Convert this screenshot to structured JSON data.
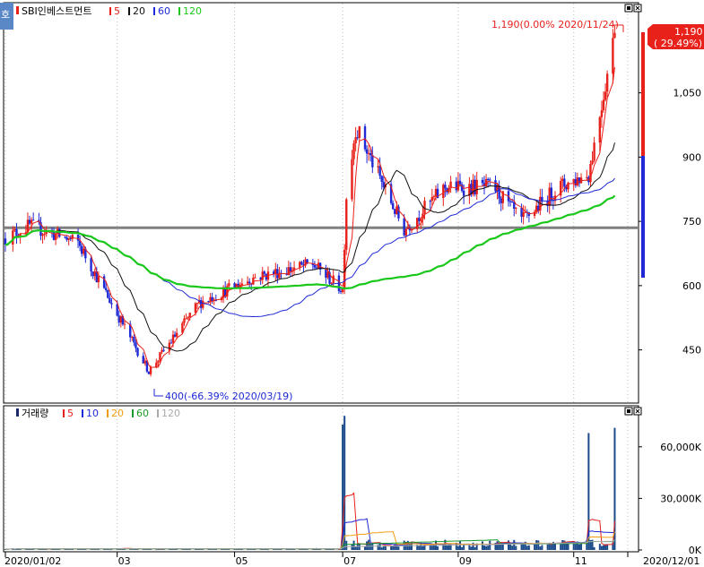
{
  "price_panel": {
    "badge": "호",
    "title": "SBI인베스트먼트",
    "legend": [
      {
        "label": "5",
        "color": "#e8211b"
      },
      {
        "label": "20",
        "color": "#111111"
      },
      {
        "label": "60",
        "color": "#1f2ad6"
      },
      {
        "label": "120",
        "color": "#19c81b"
      }
    ],
    "y_ticks": [
      {
        "label": "1,050",
        "value": 1050
      },
      {
        "label": "900",
        "value": 900
      },
      {
        "label": "750",
        "value": 750
      },
      {
        "label": "600",
        "value": 600
      },
      {
        "label": "450",
        "value": 450
      }
    ],
    "current_price": "1,190",
    "current_change": "( 29.49%)",
    "high_annotation": "1,190(0.00% 2020/11/24)",
    "low_annotation": "400(-66.39% 2020/03/19)"
  },
  "volume_panel": {
    "title": "거래량",
    "legend": [
      {
        "label": "5",
        "color": "#e8211b"
      },
      {
        "label": "10",
        "color": "#1f2ad6"
      },
      {
        "label": "20",
        "color": "#f39c12"
      },
      {
        "label": "60",
        "color": "#1a9a2a"
      },
      {
        "label": "120",
        "color": "#aaaaaa"
      }
    ],
    "y_ticks": [
      {
        "label": "60,000K",
        "value": 60000
      },
      {
        "label": "30,000K",
        "value": 30000
      },
      {
        "label": "0K",
        "value": 0
      }
    ]
  },
  "x_ticks": [
    "2020/01/02",
    "03",
    "05",
    "07",
    "09",
    "11",
    "2020/12/01"
  ],
  "colors": {
    "up": "#e8211b",
    "down": "#1f2ad6",
    "ma5": "#e8211b",
    "ma20": "#111111",
    "ma60": "#1f2ad6",
    "ma120": "#19c81b",
    "hline": "#808080"
  },
  "chart_data": {
    "type": "candlestick",
    "y_range_price": [
      330,
      1250
    ],
    "y_range_volume": [
      0,
      75000
    ],
    "horizontal_line": 735,
    "key_points": [
      {
        "date": "2020/01/02",
        "close": 710
      },
      {
        "date": "2020/01/15",
        "close": 740
      },
      {
        "date": "2020/02/10",
        "close": 700
      },
      {
        "date": "2020/03/19",
        "low": 400
      },
      {
        "date": "2020/04/15",
        "close": 560
      },
      {
        "date": "2020/05/15",
        "close": 620
      },
      {
        "date": "2020/06/15",
        "close": 650
      },
      {
        "date": "2020/07/01",
        "close": 590
      },
      {
        "date": "2020/07/03",
        "close": 810
      },
      {
        "date": "2020/07/08",
        "high": 970
      },
      {
        "date": "2020/08/03",
        "close": 730
      },
      {
        "date": "2020/08/25",
        "close": 830
      },
      {
        "date": "2020/09/20",
        "close": 830
      },
      {
        "date": "2020/10/05",
        "close": 750
      },
      {
        "date": "2020/10/25",
        "close": 830
      },
      {
        "date": "2020/11/10",
        "close": 860
      },
      {
        "date": "2020/11/24",
        "close": 1190
      }
    ],
    "volume_spikes": [
      {
        "date": "2020/07/01",
        "value": 73000
      },
      {
        "date": "2020/07/02",
        "value": 78000
      },
      {
        "date": "2020/11/10",
        "value": 68000
      },
      {
        "date": "2020/11/24",
        "value": 71000
      }
    ]
  }
}
